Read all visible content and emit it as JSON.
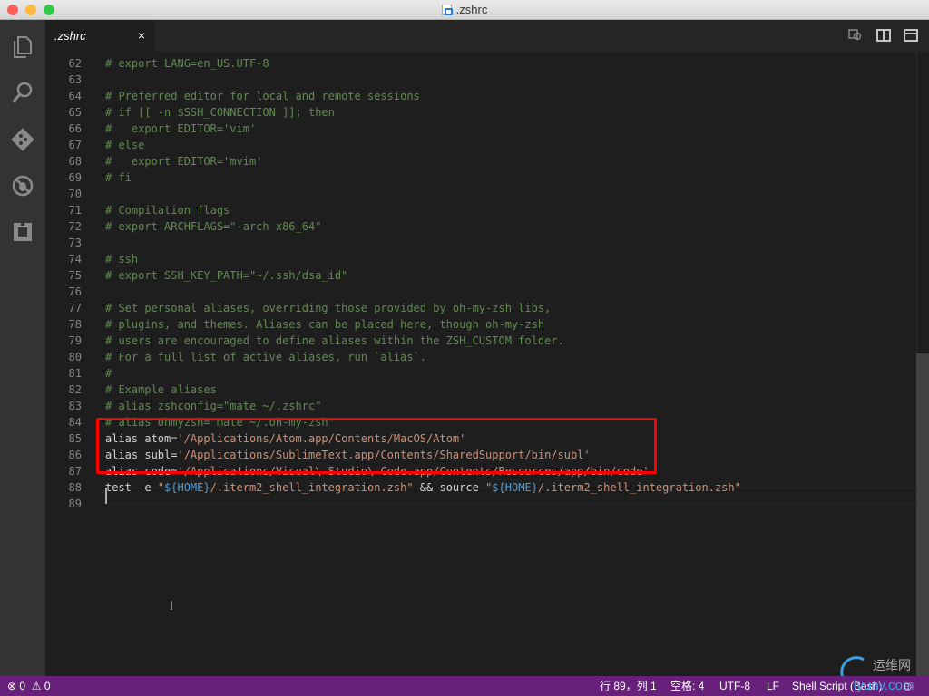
{
  "window": {
    "title": ".zshrc"
  },
  "tab": {
    "label": ".zshrc",
    "close": "×"
  },
  "editor": {
    "lines": [
      {
        "n": "62",
        "parts": [
          {
            "t": "# export LANG=en_US.UTF-8",
            "c": "cm"
          }
        ]
      },
      {
        "n": "63",
        "parts": []
      },
      {
        "n": "64",
        "parts": [
          {
            "t": "# Preferred editor for local and remote sessions",
            "c": "cm"
          }
        ]
      },
      {
        "n": "65",
        "parts": [
          {
            "t": "# if [[ -n $SSH_CONNECTION ]]; then",
            "c": "cm"
          }
        ]
      },
      {
        "n": "66",
        "parts": [
          {
            "t": "#   export EDITOR='vim'",
            "c": "cm"
          }
        ]
      },
      {
        "n": "67",
        "parts": [
          {
            "t": "# else",
            "c": "cm"
          }
        ]
      },
      {
        "n": "68",
        "parts": [
          {
            "t": "#   export EDITOR='mvim'",
            "c": "cm"
          }
        ]
      },
      {
        "n": "69",
        "parts": [
          {
            "t": "# fi",
            "c": "cm"
          }
        ]
      },
      {
        "n": "70",
        "parts": []
      },
      {
        "n": "71",
        "parts": [
          {
            "t": "# Compilation flags",
            "c": "cm"
          }
        ]
      },
      {
        "n": "72",
        "parts": [
          {
            "t": "# export ARCHFLAGS=\"-arch x86_64\"",
            "c": "cm"
          }
        ]
      },
      {
        "n": "73",
        "parts": []
      },
      {
        "n": "74",
        "parts": [
          {
            "t": "# ssh",
            "c": "cm"
          }
        ]
      },
      {
        "n": "75",
        "parts": [
          {
            "t": "# export SSH_KEY_PATH=\"~/.ssh/dsa_id\"",
            "c": "cm"
          }
        ]
      },
      {
        "n": "76",
        "parts": []
      },
      {
        "n": "77",
        "parts": [
          {
            "t": "# Set personal aliases, overriding those provided by oh-my-zsh libs,",
            "c": "cm"
          }
        ]
      },
      {
        "n": "78",
        "parts": [
          {
            "t": "# plugins, and themes. Aliases can be placed here, though oh-my-zsh",
            "c": "cm"
          }
        ]
      },
      {
        "n": "79",
        "parts": [
          {
            "t": "# users are encouraged to define aliases within the ZSH_CUSTOM folder.",
            "c": "cm"
          }
        ]
      },
      {
        "n": "80",
        "parts": [
          {
            "t": "# For a full list of active aliases, run `alias`.",
            "c": "cm"
          }
        ]
      },
      {
        "n": "81",
        "parts": [
          {
            "t": "#",
            "c": "cm"
          }
        ]
      },
      {
        "n": "82",
        "parts": [
          {
            "t": "# Example aliases",
            "c": "cm"
          }
        ]
      },
      {
        "n": "83",
        "parts": [
          {
            "t": "# alias zshconfig=\"mate ~/.zshrc\"",
            "c": "cm"
          }
        ]
      },
      {
        "n": "84",
        "parts": [
          {
            "t": "# alias ohmyzsh=\"mate ~/.oh-my-zsh\"",
            "c": "cm"
          }
        ]
      },
      {
        "n": "85",
        "parts": [
          {
            "t": "alias atom=",
            "c": ""
          },
          {
            "t": "'/Applications/Atom.app/Contents/MacOS/Atom'",
            "c": "st"
          }
        ]
      },
      {
        "n": "86",
        "parts": [
          {
            "t": "alias subl=",
            "c": ""
          },
          {
            "t": "'/Applications/SublimeText.app/Contents/SharedSupport/bin/subl'",
            "c": "st"
          }
        ]
      },
      {
        "n": "87",
        "parts": [
          {
            "t": "alias code=",
            "c": ""
          },
          {
            "t": "'/Applications/Visual\\ Studio\\ Code.app/Contents/Resources/app/bin/code'",
            "c": "st"
          }
        ]
      },
      {
        "n": "88",
        "parts": [
          {
            "t": "test -e ",
            "c": ""
          },
          {
            "t": "\"",
            "c": "st"
          },
          {
            "t": "${HOME}",
            "c": "var"
          },
          {
            "t": "/.iterm2_shell_integration.zsh\"",
            "c": "st"
          },
          {
            "t": " && source ",
            "c": ""
          },
          {
            "t": "\"",
            "c": "st"
          },
          {
            "t": "${HOME}",
            "c": "var"
          },
          {
            "t": "/.iterm2_shell_integration.zsh\"",
            "c": "st"
          }
        ]
      },
      {
        "n": "89",
        "parts": []
      }
    ]
  },
  "status": {
    "errors": "0",
    "warnings": "0",
    "position": "行 89，列 1",
    "spaces": "空格: 4",
    "encoding": "UTF-8",
    "eol": "LF",
    "language": "Shell Script (Bash)"
  },
  "watermark": {
    "text": "运维网",
    "site": "iyunv.com"
  },
  "colors": {
    "status_bar": "#68217a",
    "highlight_box": "#ff0000"
  }
}
